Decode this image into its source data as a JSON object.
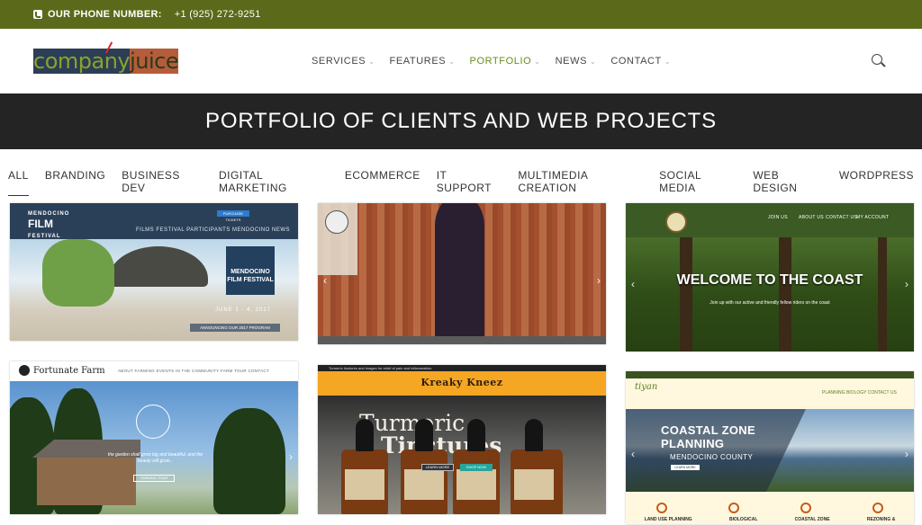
{
  "topbar": {
    "phone_label": "OUR PHONE NUMBER:",
    "phone_number": "+1 (925) 272-9251"
  },
  "brand": {
    "part1": "company",
    "part2": "juice"
  },
  "nav": [
    {
      "label": "SERVICES"
    },
    {
      "label": "FEATURES"
    },
    {
      "label": "PORTFOLIO",
      "active": true
    },
    {
      "label": "NEWS"
    },
    {
      "label": "CONTACT"
    }
  ],
  "banner": {
    "title": "PORTFOLIO OF CLIENTS AND WEB PROJECTS"
  },
  "filters": [
    "ALL",
    "BRANDING",
    "BUSINESS DEV",
    "DIGITAL MARKETING",
    "ECOMMERCE",
    "IT SUPPORT",
    "MULTIMEDIA CREATION",
    "SOCIAL MEDIA",
    "WEB DESIGN",
    "WORDPRESS"
  ],
  "cards": {
    "film": {
      "logo_top": "MENDOCINO",
      "logo_main": "FILM",
      "logo_sub": "FESTIVAL",
      "menu": "FILMS   FESTIVAL   PARTICIPANTS   MENDOCINO   NEWS",
      "button": "PURCHASE TICKETS",
      "badge": "MENDOCINO FILM FESTIVAL",
      "date": "JUNE 1 - 4, 2017",
      "announce": "ANNOUNCING OUR 2017 PROGRAM"
    },
    "coast": {
      "links": [
        "JOIN US",
        "ABOUT US",
        "CONTACT US",
        "MY ACCOUNT"
      ],
      "title": "WELCOME TO THE COAST",
      "subtitle": "Join up with our active and friendly fellow riders on the coast"
    },
    "farm": {
      "logo": "Fortunate Farm",
      "menu": "ABOUT   FARMING   EVENTS   IN THE COMMUNITY   FARM TOUR   CONTACT",
      "quote": "the garden shall grow big and beautiful, and the beauty will grow...",
      "button": "FARMING TOUR"
    },
    "tinctures": {
      "strip": "Turmeric tinctures and images for relief of pain and inflammation.",
      "logo": "Kreaky Kneez",
      "head1": "Turmeric",
      "head2": "Tinctures",
      "btn1": "LEARN MORE",
      "btn2": "SHOP NOW"
    },
    "planning": {
      "logo": "tiyan",
      "nav": "PLANNING    BIOLOGY    CONTACT US",
      "title1": "COASTAL ZONE",
      "title2": "PLANNING",
      "subtitle": "MENDOCINO COUNTY",
      "button": "LEARN MORE",
      "icons": [
        "LAND USE PLANNING",
        "BIOLOGICAL",
        "COASTAL ZONE",
        "REZONING &"
      ]
    }
  }
}
